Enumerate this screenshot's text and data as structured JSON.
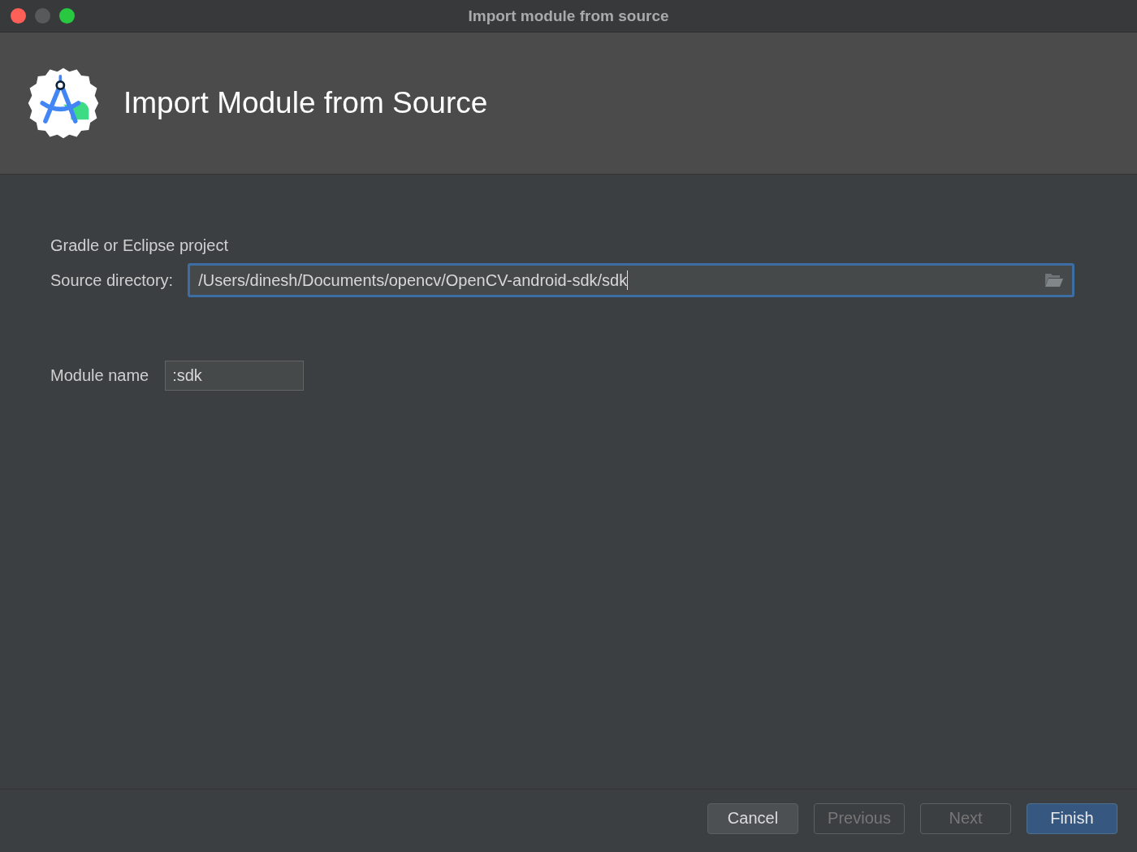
{
  "window": {
    "title": "Import module from source",
    "controls": [
      {
        "color": "#fe5f57"
      },
      {
        "color": "#58595b"
      },
      {
        "color": "#28c840"
      }
    ]
  },
  "header": {
    "title": "Import Module from Source"
  },
  "form": {
    "section": "Gradle or Eclipse project",
    "source": {
      "label": "Source directory:",
      "value": "/Users/dinesh/Documents/opencv/OpenCV-android-sdk/sdk",
      "focused": true
    },
    "module": {
      "label": "Module name",
      "value": ":sdk",
      "focused": false
    }
  },
  "buttons": [
    {
      "label": "Cancel",
      "kind": "default",
      "disabled": false
    },
    {
      "label": "Previous",
      "kind": "default",
      "disabled": true
    },
    {
      "label": "Next",
      "kind": "default",
      "disabled": true
    },
    {
      "label": "Finish",
      "kind": "primary",
      "disabled": false
    }
  ]
}
